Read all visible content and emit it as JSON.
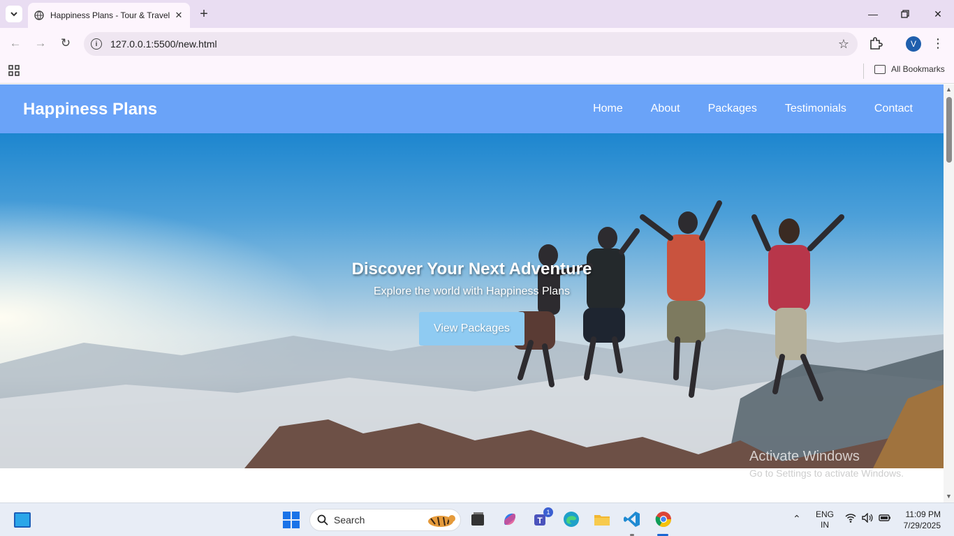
{
  "browser": {
    "tab_title": "Happiness Plans - Tour & Travel",
    "url": "127.0.0.1:5500/new.html",
    "profile_initial": "V",
    "bookmarks_label": "All Bookmarks"
  },
  "site": {
    "logo": "Happiness Plans",
    "nav": [
      "Home",
      "About",
      "Packages",
      "Testimonials",
      "Contact"
    ],
    "hero": {
      "title": "Discover Your Next Adventure",
      "subtitle": "Explore the world with Happiness Plans",
      "button": "View Packages"
    }
  },
  "watermark": {
    "line1": "Activate Windows",
    "line2": "Go to Settings to activate Windows."
  },
  "taskbar": {
    "search_placeholder": "Search",
    "teams_badge": "1",
    "lang_top": "ENG",
    "lang_bottom": "IN",
    "time": "11:09 PM",
    "date": "7/29/2025"
  },
  "colors": {
    "header_bg": "#6aa3f8",
    "hero_button": "#8fcbf2",
    "browser_frame": "#e9ddf2"
  }
}
